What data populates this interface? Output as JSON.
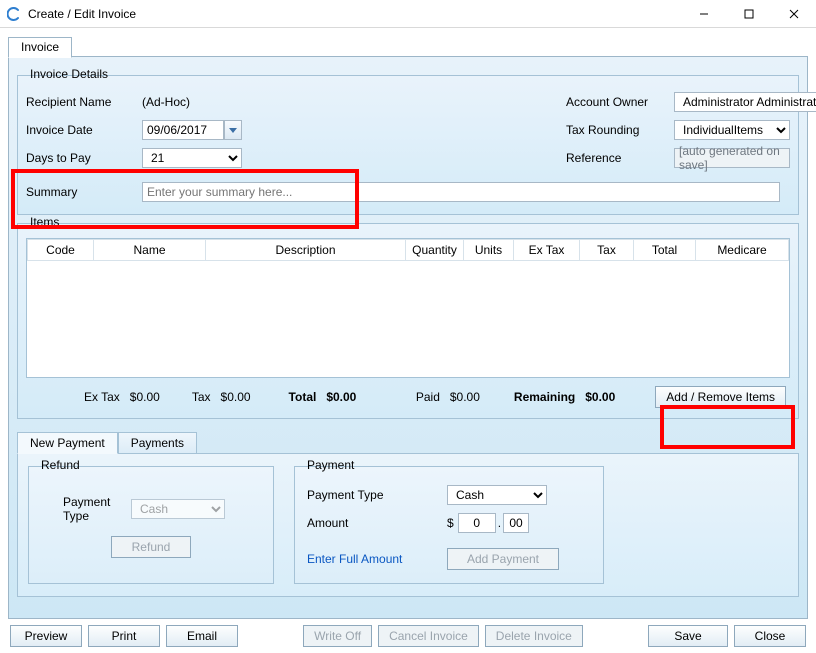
{
  "window": {
    "title": "Create / Edit Invoice"
  },
  "main_tab": {
    "label": "Invoice"
  },
  "invoice_details": {
    "legend": "Invoice Details",
    "recipient_label": "Recipient Name",
    "recipient_value": "(Ad-Hoc)",
    "invoice_date_label": "Invoice Date",
    "invoice_date_value": "09/06/2017",
    "days_to_pay_label": "Days to Pay",
    "days_to_pay_value": "21",
    "summary_label": "Summary",
    "summary_placeholder": "Enter your summary here...",
    "account_owner_label": "Account Owner",
    "account_owner_value": "Administrator Administrator",
    "tax_rounding_label": "Tax Rounding",
    "tax_rounding_value": "IndividualItems",
    "reference_label": "Reference",
    "reference_placeholder": "[auto generated on save]"
  },
  "items": {
    "legend": "Items",
    "columns": {
      "code": "Code",
      "name": "Name",
      "description": "Description",
      "quantity": "Quantity",
      "units": "Units",
      "ex_tax": "Ex Tax",
      "tax": "Tax",
      "total": "Total",
      "medicare": "Medicare"
    },
    "totals": {
      "ex_tax_label": "Ex Tax",
      "ex_tax_value": "$0.00",
      "tax_label": "Tax",
      "tax_value": "$0.00",
      "total_label": "Total",
      "total_value": "$0.00",
      "paid_label": "Paid",
      "paid_value": "$0.00",
      "remaining_label": "Remaining",
      "remaining_value": "$0.00"
    },
    "add_remove_label": "Add / Remove Items"
  },
  "payment_tabs": {
    "tab_new": "New Payment",
    "tab_payments": "Payments",
    "refund": {
      "legend": "Refund",
      "type_label": "Payment Type",
      "type_value": "Cash",
      "button_label": "Refund"
    },
    "payment": {
      "legend": "Payment",
      "type_label": "Payment Type",
      "type_value": "Cash",
      "amount_label": "Amount",
      "currency": "$",
      "amount_int": "0",
      "amount_dec": "00",
      "enter_full_link": "Enter Full Amount",
      "add_button_label": "Add Payment"
    }
  },
  "buttons": {
    "preview": "Preview",
    "print": "Print",
    "email": "Email",
    "write_off": "Write Off",
    "cancel_invoice": "Cancel Invoice",
    "delete_invoice": "Delete Invoice",
    "save": "Save",
    "close": "Close"
  }
}
